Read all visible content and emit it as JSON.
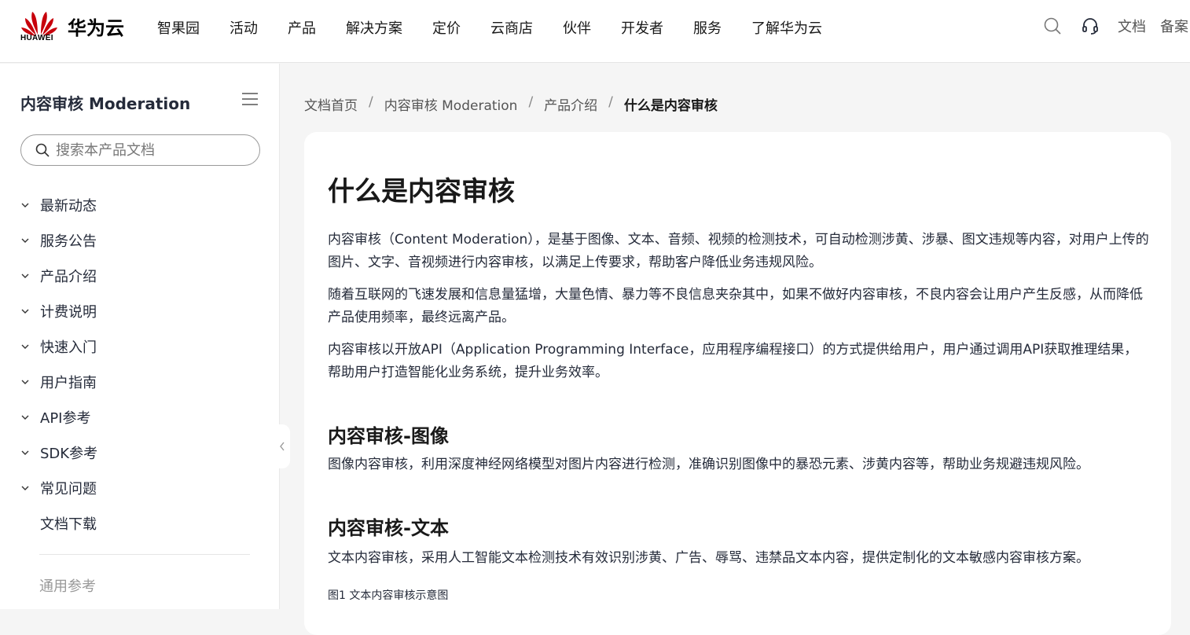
{
  "header": {
    "logo_text": "HUAWEI",
    "brand": "华为云",
    "nav": [
      "智果园",
      "活动",
      "产品",
      "解决方案",
      "定价",
      "云商店",
      "伙伴",
      "开发者",
      "服务",
      "了解华为云"
    ],
    "right_links": [
      "文档",
      "备案"
    ],
    "icons": [
      "search-icon",
      "headset-icon"
    ]
  },
  "sidebar": {
    "title": "内容审核 Moderation",
    "search_placeholder": "搜索本产品文档",
    "items": [
      {
        "label": "最新动态",
        "expandable": true
      },
      {
        "label": "服务公告",
        "expandable": true
      },
      {
        "label": "产品介绍",
        "expandable": true
      },
      {
        "label": "计费说明",
        "expandable": true
      },
      {
        "label": "快速入门",
        "expandable": true
      },
      {
        "label": "用户指南",
        "expandable": true
      },
      {
        "label": "API参考",
        "expandable": true
      },
      {
        "label": "SDK参考",
        "expandable": true
      },
      {
        "label": "常见问题",
        "expandable": true
      },
      {
        "label": "文档下载",
        "expandable": false
      }
    ],
    "footer": "通用参考"
  },
  "breadcrumb": [
    "文档首页",
    "内容审核 Moderation",
    "产品介绍",
    "什么是内容审核"
  ],
  "article": {
    "title": "什么是内容审核",
    "paragraphs": [
      "内容审核（Content Moderation），是基于图像、文本、音频、视频的检测技术，可自动检测涉黄、涉暴、图文违规等内容，对用户上传的图片、文字、音视频进行内容审核，以满足上传要求，帮助客户降低业务违规风险。",
      "随着互联网的飞速发展和信息量猛增，大量色情、暴力等不良信息夹杂其中，如果不做好内容审核，不良内容会让用户产生反感，从而降低产品使用频率，最终远离产品。",
      "内容审核以开放API（Application Programming Interface，应用程序编程接口）的方式提供给用户，用户通过调用API获取推理结果，帮助用户打造智能化业务系统，提升业务效率。"
    ],
    "sections": [
      {
        "heading": "内容审核-图像",
        "text": "图像内容审核，利用深度神经网络模型对图片内容进行检测，准确识别图像中的暴恐元素、涉黄内容等，帮助业务规避违规风险。"
      },
      {
        "heading": "内容审核-文本",
        "text": "文本内容审核，采用人工智能文本检测技术有效识别涉黄、广告、辱骂、违禁品文本内容，提供定制化的文本敏感内容审核方案。"
      }
    ],
    "figure_caption": "图1 文本内容审核示意图"
  },
  "colors": {
    "brand_red": "#c7000b",
    "text": "#252b3a",
    "background": "#f5f5f5"
  }
}
